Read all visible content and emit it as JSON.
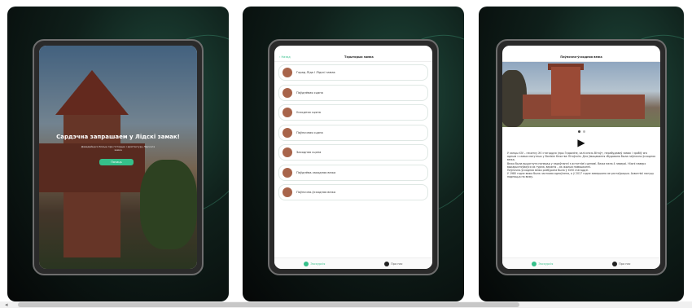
{
  "screens": [
    {
      "welcome_title": "Сардэчна запрашаем у Лідскі замак!",
      "welcome_text": "Даведайцеся больш пра гісторыю і архітэктуру Лідскага замка",
      "button_label": "Пачаць"
    },
    {
      "back_label": "‹ Назад",
      "title": "Тэрыторыя замка",
      "items": [
        "Горад Ліда і Лідскі замак",
        "Паўднёвая сцяна",
        "Усходняя сцяна",
        "Паўночная сцяна",
        "Заходняя сцяна",
        "Паўднёва-заходняя вежа",
        "Паўночна-ўсходняя вежа"
      ],
      "tabs": [
        "Экскурсія",
        "Пра нас"
      ]
    },
    {
      "title": "Паўночна-ўсходняя вежа",
      "play_symbol": "▶",
      "description": [
        "У канцы XIV – пачатку XV стагоддзя (пры Гедыміне, калі князь Вітаўт, перабудаваў замак і зрабіў яго адным з самых магутных у Вялікім Княстве Літоўскім. Для ўмацавання збудавана была паўночна-ўсходняя вежа.",
        "Вежа была выцягнута наперад у параўнанні з астатнімі сценамі. Вежа мела 4 паверхі. Ніжні паверх выкарыстоўваўся як турма, верхнія – як жылыя памяшканні.",
        "Паўночна-ўсходняя вежа разбурана была ў XVIII стагоддзі.",
        "У 1980 годзе вежа была часткова адноўлена, а ў 2017 годзе завершана яе рэстаўрацыя. Ахвотнікі могуць падняцца на вежу."
      ],
      "tabs": [
        "Экскурсія",
        "Пра нас"
      ]
    }
  ],
  "scrollbar": {
    "arrow": "◂"
  },
  "colors": {
    "accent": "#35c08a"
  }
}
